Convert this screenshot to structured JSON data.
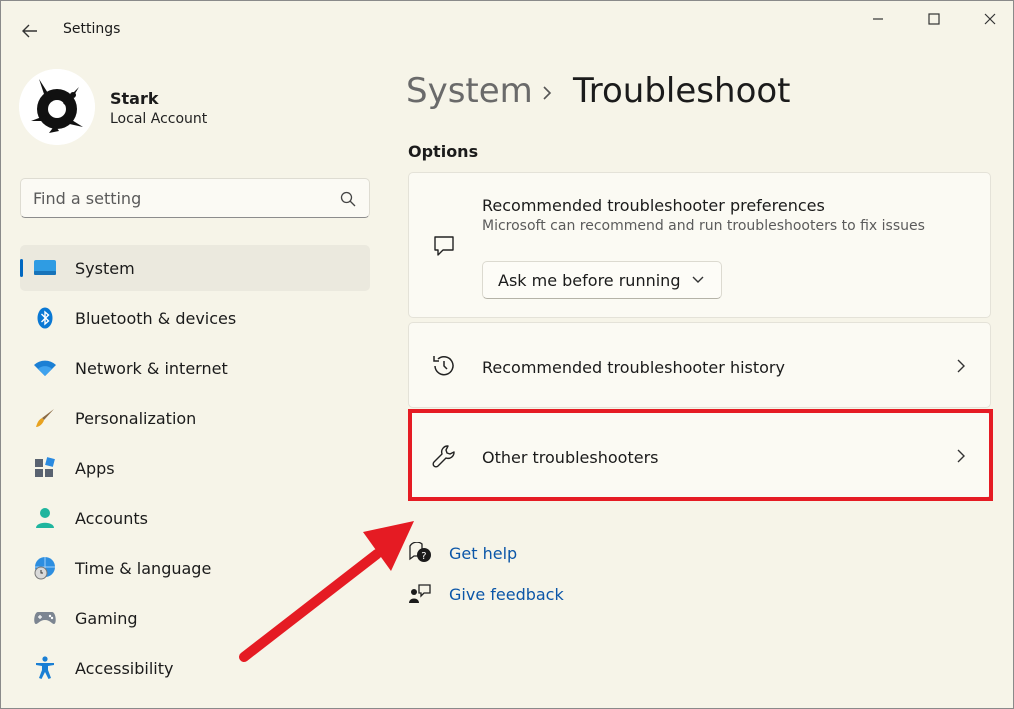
{
  "window": {
    "app_title": "Settings"
  },
  "profile": {
    "name": "Stark",
    "account_type": "Local Account"
  },
  "search": {
    "placeholder": "Find a setting"
  },
  "nav": {
    "items": [
      {
        "label": "System",
        "icon": "system-icon",
        "active": true
      },
      {
        "label": "Bluetooth & devices",
        "icon": "bluetooth-icon"
      },
      {
        "label": "Network & internet",
        "icon": "wifi-icon"
      },
      {
        "label": "Personalization",
        "icon": "brush-icon"
      },
      {
        "label": "Apps",
        "icon": "apps-icon"
      },
      {
        "label": "Accounts",
        "icon": "accounts-icon"
      },
      {
        "label": "Time & language",
        "icon": "globe-clock-icon"
      },
      {
        "label": "Gaming",
        "icon": "gamepad-icon"
      },
      {
        "label": "Accessibility",
        "icon": "accessibility-icon"
      }
    ]
  },
  "breadcrumb": {
    "parent": "System",
    "current": "Troubleshoot"
  },
  "options": {
    "section_title": "Options",
    "preferences": {
      "title": "Recommended troubleshooter preferences",
      "subtitle": "Microsoft can recommend and run troubleshooters to fix issues",
      "dropdown_value": "Ask me before running"
    },
    "history": {
      "title": "Recommended troubleshooter history"
    },
    "other": {
      "title": "Other troubleshooters"
    }
  },
  "links": {
    "get_help": "Get help",
    "give_feedback": "Give feedback"
  },
  "colors": {
    "accent": "#0067c0",
    "highlight": "#e51b23",
    "link": "#0b56a8"
  }
}
